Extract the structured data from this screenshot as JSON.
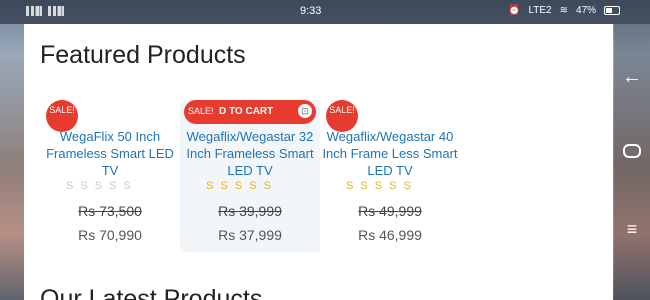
{
  "status_bar": {
    "time": "9:33",
    "network": "LTE2",
    "battery": "47%"
  },
  "section": {
    "featured_title": "Featured Products",
    "latest_title": "Our Latest Products"
  },
  "products": [
    {
      "sale_badge": "SALE!",
      "title": "WegaFlix 50 Inch Frameless Smart LED TV",
      "stars": "S S S S S",
      "stars_style": "grey",
      "old_price": "Rs 73,500",
      "new_price": "Rs 70,990"
    },
    {
      "sale_badge": "SALE!",
      "add_to_cart": "D TO CART",
      "cart_icon": "cart-icon",
      "title": "Wegaflix/Wegastar 32 Inch Frameless Smart LED TV",
      "stars": "S S S S S",
      "stars_style": "gold",
      "old_price": "Rs 39,999",
      "new_price": "Rs 37,999"
    },
    {
      "sale_badge": "SALE!",
      "title": "Wegaflix/Wegastar 40 Inch Frame Less Smart LED TV",
      "stars": "S S S S S",
      "stars_style": "gold",
      "old_price": "Rs 49,999",
      "new_price": "Rs 46,999"
    }
  ],
  "colors": {
    "sale_red": "#e63b2e",
    "link_blue": "#1f73b8",
    "star_gold": "#e0b42a"
  },
  "nav_icons": [
    "back-icon",
    "home-icon",
    "menu-icon"
  ]
}
